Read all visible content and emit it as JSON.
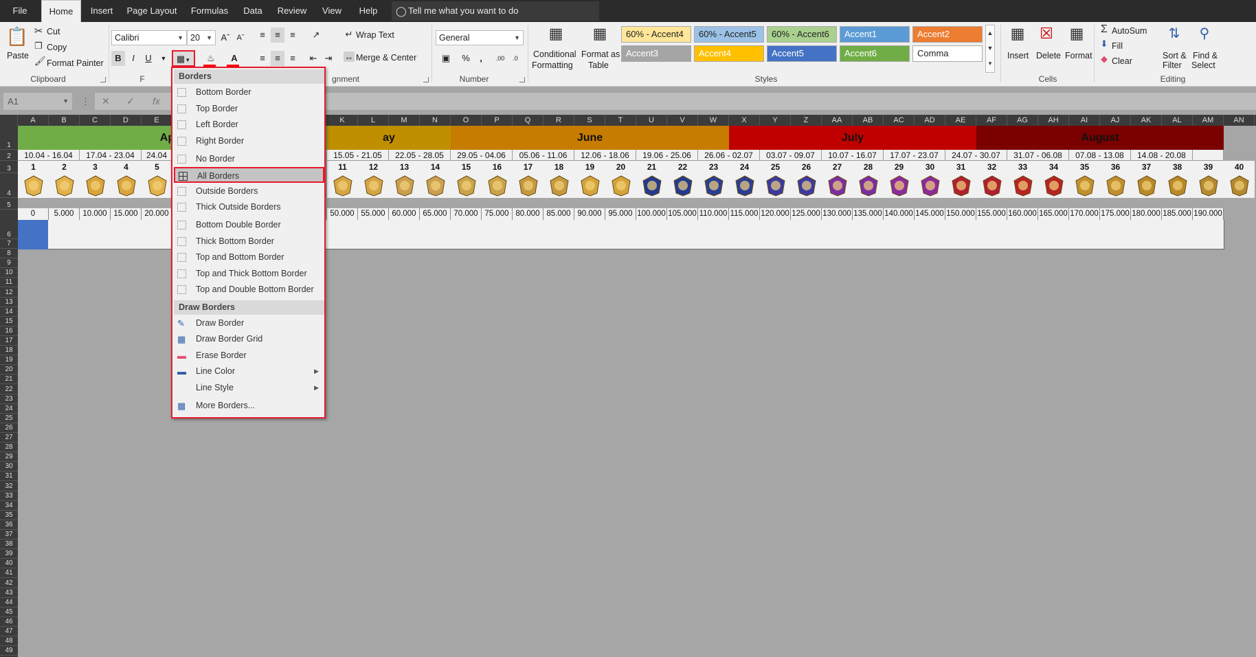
{
  "menu_tabs": [
    "File",
    "Home",
    "Insert",
    "Page Layout",
    "Formulas",
    "Data",
    "Review",
    "View",
    "Help"
  ],
  "active_tab": "Home",
  "tell_me": "Tell me what you want to do",
  "ribbon": {
    "clipboard": {
      "label": "Clipboard",
      "paste": "Paste",
      "cut": "Cut",
      "copy": "Copy",
      "format_painter": "Format Painter"
    },
    "font": {
      "label": "F",
      "name": "Calibri",
      "size": "20",
      "bold": "B",
      "italic": "I",
      "underline": "U"
    },
    "alignment": {
      "label": "gnment",
      "wrap_text": "Wrap Text",
      "merge_center": "Merge & Center"
    },
    "number": {
      "label": "Number",
      "format": "General",
      "percent": "%",
      "comma": ","
    },
    "styles": {
      "label": "Styles",
      "conditional": "Conditional",
      "conditional2": "Formatting",
      "format_as": "Format as",
      "format_as2": "Table",
      "cells": [
        {
          "name": "60% - Accent4",
          "bg": "#ffe699",
          "fg": "#222"
        },
        {
          "name": "60% - Accent5",
          "bg": "#9bc2e6",
          "fg": "#222"
        },
        {
          "name": "60% - Accent6",
          "bg": "#a9d08e",
          "fg": "#222"
        },
        {
          "name": "Accent1",
          "bg": "#5b9bd5",
          "fg": "#ffffff"
        },
        {
          "name": "Accent2",
          "bg": "#ed7d31",
          "fg": "#ffffff"
        },
        {
          "name": "Accent3",
          "bg": "#a5a5a5",
          "fg": "#ffffff"
        },
        {
          "name": "Accent4",
          "bg": "#ffc000",
          "fg": "#ffffff"
        },
        {
          "name": "Accent5",
          "bg": "#4472c4",
          "fg": "#ffffff"
        },
        {
          "name": "Accent6",
          "bg": "#70ad47",
          "fg": "#ffffff"
        },
        {
          "name": "Comma",
          "bg": "#ffffff",
          "fg": "#222"
        }
      ]
    },
    "cells": {
      "label": "Cells",
      "insert": "Insert",
      "delete": "Delete",
      "format": "Format"
    },
    "editing": {
      "label": "Editing",
      "autosum": "AutoSum",
      "fill": "Fill",
      "clear": "Clear",
      "sort": "Sort &",
      "sort2": "Filter",
      "find": "Find &",
      "find2": "Select"
    }
  },
  "name_box": "A1",
  "columns": [
    "A",
    "B",
    "C",
    "D",
    "E",
    "",
    "",
    "",
    "",
    "",
    "K",
    "L",
    "M",
    "N",
    "O",
    "P",
    "Q",
    "R",
    "S",
    "T",
    "U",
    "V",
    "W",
    "X",
    "Y",
    "Z",
    "AA",
    "AB",
    "AC",
    "AD",
    "AE",
    "AF",
    "AG",
    "AH",
    "AI",
    "AJ",
    "AK",
    "AL",
    "AM",
    "AN"
  ],
  "rows": [
    "1",
    "2",
    "3",
    "4",
    "5",
    "6",
    "7",
    "8",
    "9",
    "10",
    "11",
    "12",
    "13",
    "14",
    "15",
    "16",
    "17",
    "18",
    "19",
    "20",
    "21",
    "22",
    "23",
    "24",
    "25",
    "26",
    "27",
    "28",
    "29",
    "30",
    "31",
    "32",
    "33",
    "34",
    "35",
    "36",
    "37",
    "38",
    "39",
    "40",
    "41",
    "42",
    "43",
    "44",
    "45",
    "46",
    "47",
    "48",
    "49"
  ],
  "months": [
    {
      "name": "April",
      "color": "#70ad47"
    },
    {
      "name": "ay",
      "color": "#bf8f00"
    },
    {
      "name": "June",
      "color": "#c67c00"
    },
    {
      "name": "July",
      "color": "#c00000"
    },
    {
      "name": "August",
      "color": "#7b0000"
    }
  ],
  "weeks": [
    "10.04 - 16.04",
    "17.04 - 23.04",
    "24.04",
    "15.05 - 21.05",
    "22.05 - 28.05",
    "29.05 - 04.06",
    "05.06 - 11.06",
    "12.06 - 18.06",
    "19.06 - 25.06",
    "26.06 - 02.07",
    "03.07 - 09.07",
    "10.07 - 16.07",
    "17.07 - 23.07",
    "24.07 - 30.07",
    "31.07 - 06.08",
    "07.08 - 13.08",
    "14.08 - 20.08"
  ],
  "levels": [
    "1",
    "2",
    "3",
    "4",
    "5",
    "11",
    "12",
    "13",
    "14",
    "15",
    "16",
    "17",
    "18",
    "19",
    "20",
    "21",
    "22",
    "23",
    "24",
    "25",
    "26",
    "27",
    "28",
    "29",
    "30",
    "31",
    "32",
    "33",
    "34",
    "35",
    "36",
    "37",
    "38",
    "39",
    "40"
  ],
  "points": [
    "0",
    "5.000",
    "10.000",
    "15.000",
    "20.000",
    "50.000",
    "55.000",
    "60.000",
    "65.000",
    "70.000",
    "75.000",
    "80.000",
    "85.000",
    "90.000",
    "95.000",
    "100.000",
    "105.000",
    "110.000",
    "115.000",
    "120.000",
    "125.000",
    "130.000",
    "135.000",
    "140.000",
    "145.000",
    "150.000",
    "155.000",
    "160.000",
    "165.000",
    "170.000",
    "175.000",
    "180.000",
    "185.000",
    "190.000"
  ],
  "borders_menu": {
    "section1": "Borders",
    "items1": [
      "Bottom Border",
      "Top Border",
      "Left Border",
      "Right Border",
      "No Border",
      "All Borders",
      "Outside Borders",
      "Thick Outside Borders",
      "Bottom Double Border",
      "Thick Bottom Border",
      "Top and Bottom Border",
      "Top and Thick Bottom Border",
      "Top and Double Bottom Border"
    ],
    "section2": "Draw Borders",
    "items2": [
      "Draw Border",
      "Draw Border Grid",
      "Erase Border",
      "Line Color",
      "Line Style",
      "More Borders..."
    ],
    "highlighted": "All Borders"
  }
}
